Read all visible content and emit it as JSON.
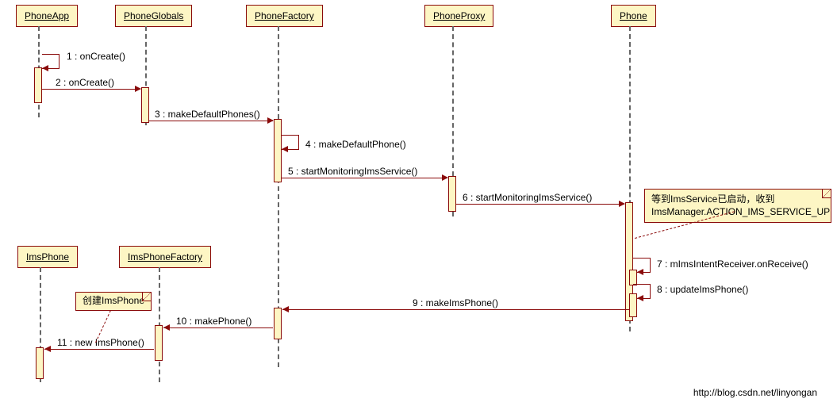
{
  "participants": {
    "phoneApp": "PhoneApp",
    "phoneGlobals": "PhoneGlobals",
    "phoneFactory": "PhoneFactory",
    "phoneProxy": "PhoneProxy",
    "phone": "Phone",
    "imsPhone": "ImsPhone",
    "imsPhoneFactory": "ImsPhoneFactory"
  },
  "messages": {
    "m1": "1 : onCreate()",
    "m2": "2 : onCreate()",
    "m3": "3 : makeDefaultPhones()",
    "m4": "4 : makeDefaultPhone()",
    "m5": "5 : startMonitoringImsService()",
    "m6": "6 : startMonitoringImsService()",
    "m7": "7 : mImsIntentReceiver.onReceive()",
    "m8": "8 : updateImsPhone()",
    "m9": "9 : makeImsPhone()",
    "m10": "10 : makePhone()",
    "m11": "11 : new ImsPhone()"
  },
  "notes": {
    "n1_line1": "等到ImsService已启动，收到",
    "n1_line2": "ImsManager.ACTION_IMS_SERVICE_UP",
    "n2": "创建ImsPhone"
  },
  "footer": "http://blog.csdn.net/linyongan",
  "chart_data": {
    "type": "sequence_diagram",
    "participants": [
      "PhoneApp",
      "PhoneGlobals",
      "PhoneFactory",
      "PhoneProxy",
      "Phone",
      "ImsPhone",
      "ImsPhoneFactory"
    ],
    "messages": [
      {
        "n": 1,
        "from": "PhoneApp",
        "to": "PhoneApp",
        "label": "onCreate()"
      },
      {
        "n": 2,
        "from": "PhoneApp",
        "to": "PhoneGlobals",
        "label": "onCreate()"
      },
      {
        "n": 3,
        "from": "PhoneGlobals",
        "to": "PhoneFactory",
        "label": "makeDefaultPhones()"
      },
      {
        "n": 4,
        "from": "PhoneFactory",
        "to": "PhoneFactory",
        "label": "makeDefaultPhone()"
      },
      {
        "n": 5,
        "from": "PhoneFactory",
        "to": "PhoneProxy",
        "label": "startMonitoringImsService()"
      },
      {
        "n": 6,
        "from": "PhoneProxy",
        "to": "Phone",
        "label": "startMonitoringImsService()"
      },
      {
        "n": 7,
        "from": "Phone",
        "to": "Phone",
        "label": "mImsIntentReceiver.onReceive()"
      },
      {
        "n": 8,
        "from": "Phone",
        "to": "Phone",
        "label": "updateImsPhone()"
      },
      {
        "n": 9,
        "from": "Phone",
        "to": "PhoneFactory",
        "label": "makeImsPhone()"
      },
      {
        "n": 10,
        "from": "PhoneFactory",
        "to": "ImsPhoneFactory",
        "label": "makePhone()"
      },
      {
        "n": 11,
        "from": "ImsPhoneFactory",
        "to": "ImsPhone",
        "label": "new ImsPhone()"
      }
    ],
    "notes": [
      {
        "attached_to": "Phone",
        "text": "等到ImsService已启动，收到 ImsManager.ACTION_IMS_SERVICE_UP"
      },
      {
        "attached_to": "ImsPhoneFactory→ImsPhone",
        "text": "创建ImsPhone"
      }
    ]
  }
}
